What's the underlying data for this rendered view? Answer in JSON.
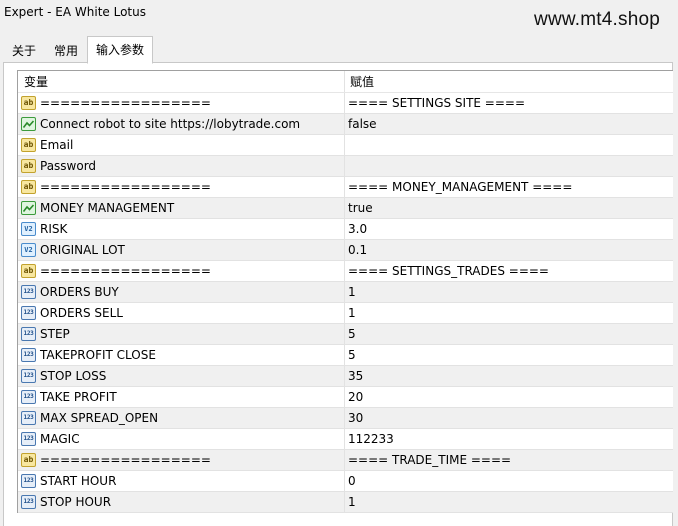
{
  "window": {
    "title": "Expert - EA White Lotus"
  },
  "watermark": "www.mt4.shop",
  "tabs": [
    {
      "label": "关于",
      "active": false
    },
    {
      "label": "常用",
      "active": false
    },
    {
      "label": "输入参数",
      "active": true
    }
  ],
  "table": {
    "headers": {
      "variable": "变量",
      "value": "赋值"
    },
    "rows": [
      {
        "icon": "ab",
        "name": "=================",
        "value": "==== SETTINGS SITE ===="
      },
      {
        "icon": "bool",
        "name": "Connect robot to site https://lobytrade.com",
        "value": "false"
      },
      {
        "icon": "ab",
        "name": "Email",
        "value": ""
      },
      {
        "icon": "ab",
        "name": "Password",
        "value": ""
      },
      {
        "icon": "ab",
        "name": "=================",
        "value": "==== MONEY_MANAGEMENT ===="
      },
      {
        "icon": "bool",
        "name": "MONEY MANAGEMENT",
        "value": "true"
      },
      {
        "icon": "double",
        "name": "RISK",
        "value": "3.0"
      },
      {
        "icon": "double",
        "name": "ORIGINAL LOT",
        "value": "0.1"
      },
      {
        "icon": "ab",
        "name": "=================",
        "value": "==== SETTINGS_TRADES ===="
      },
      {
        "icon": "int",
        "name": "ORDERS BUY",
        "value": "1"
      },
      {
        "icon": "int",
        "name": "ORDERS SELL",
        "value": "1"
      },
      {
        "icon": "int",
        "name": "STEP",
        "value": "5"
      },
      {
        "icon": "int",
        "name": "TAKEPROFIT CLOSE",
        "value": "5"
      },
      {
        "icon": "int",
        "name": "STOP LOSS",
        "value": "35"
      },
      {
        "icon": "int",
        "name": "TAKE PROFIT",
        "value": "20"
      },
      {
        "icon": "int",
        "name": "MAX SPREAD_OPEN",
        "value": "30"
      },
      {
        "icon": "int",
        "name": "MAGIC",
        "value": "112233"
      },
      {
        "icon": "ab",
        "name": "=================",
        "value": "==== TRADE_TIME ===="
      },
      {
        "icon": "int",
        "name": "START HOUR",
        "value": "0"
      },
      {
        "icon": "int",
        "name": "STOP HOUR",
        "value": "1"
      }
    ]
  }
}
